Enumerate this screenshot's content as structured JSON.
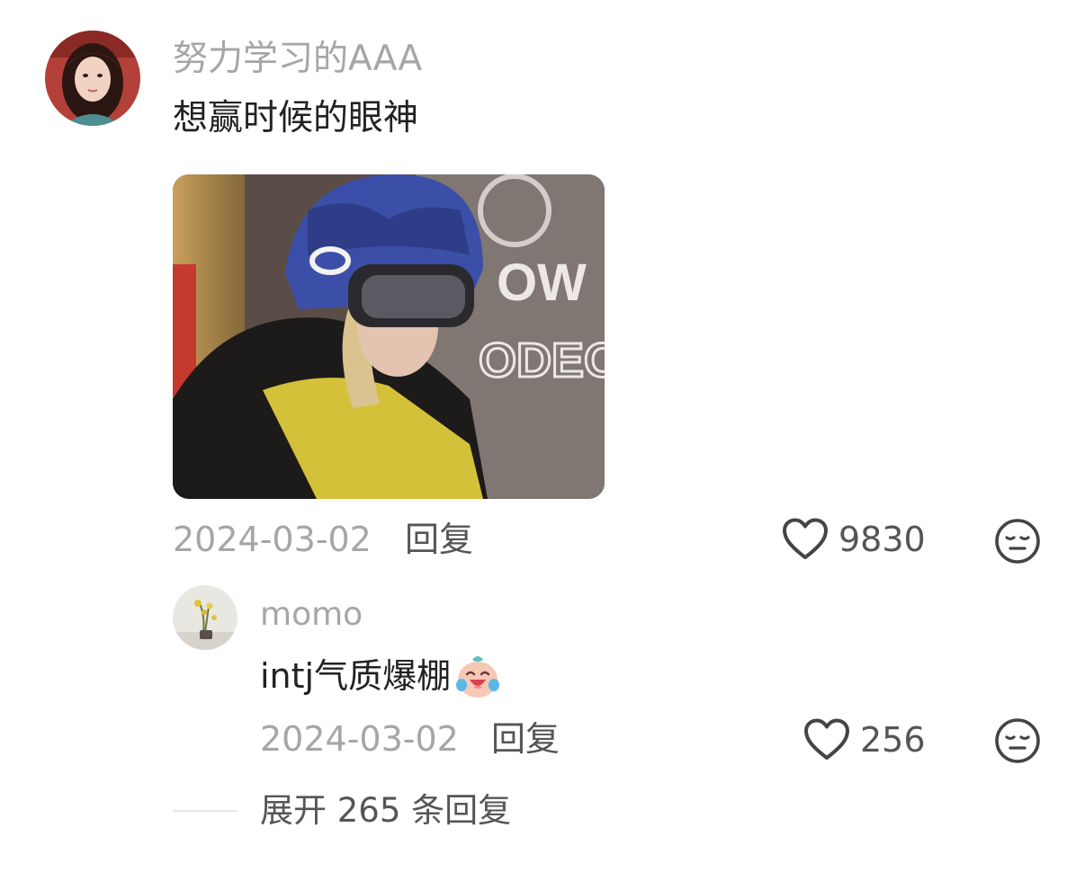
{
  "comment": {
    "username": "努力学习的AAA",
    "text": "想赢时候的眼神",
    "avatar_icon": "avatar-woman-portrait",
    "image_icon": "photo-snowboarder-helmet-goggles",
    "date": "2024-03-02",
    "reply_label": "回复",
    "like_icon": "heart-outline-icon",
    "likes": "9830",
    "dislike_icon": "meh-face-icon"
  },
  "reply": {
    "username": "momo",
    "text": "intj气质爆棚",
    "emoji_icon": "crying-laughing-emoji",
    "avatar_icon": "avatar-flower-vase",
    "date": "2024-03-02",
    "reply_label": "回复",
    "like_icon": "heart-outline-icon",
    "likes": "256",
    "dislike_icon": "meh-face-icon"
  },
  "expand": {
    "label": "展开 265 条回复"
  },
  "colors": {
    "meta_gray": "#a6a6a6",
    "action_gray": "#555555",
    "text": "#222222"
  }
}
